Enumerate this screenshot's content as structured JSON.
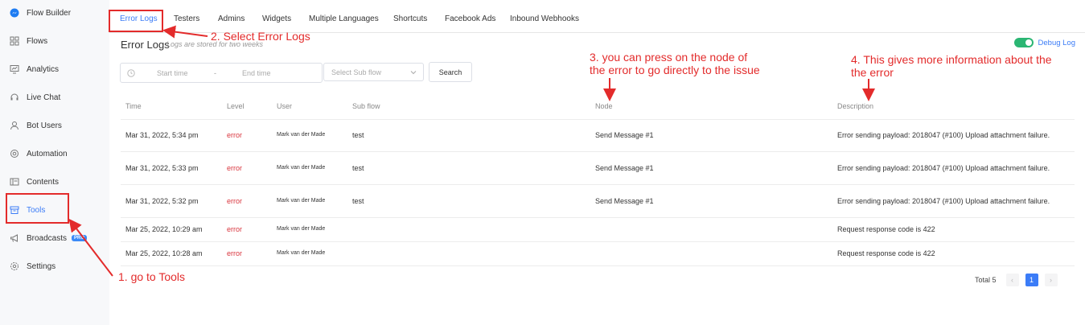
{
  "sidebar": {
    "items": [
      {
        "label": "Flow Builder",
        "icon": "messenger-icon"
      },
      {
        "label": "Flows",
        "icon": "grid-icon"
      },
      {
        "label": "Analytics",
        "icon": "chart-icon"
      },
      {
        "label": "Live Chat",
        "icon": "headset-icon"
      },
      {
        "label": "Bot Users",
        "icon": "user-icon"
      },
      {
        "label": "Automation",
        "icon": "automation-icon"
      },
      {
        "label": "Contents",
        "icon": "contents-icon"
      },
      {
        "label": "Tools",
        "icon": "tools-icon"
      },
      {
        "label": "Broadcasts",
        "icon": "megaphone-icon",
        "badge": "PRO"
      },
      {
        "label": "Settings",
        "icon": "gear-icon"
      }
    ],
    "active_item": "Tools"
  },
  "tabs": [
    "Error Logs",
    "Testers",
    "Admins",
    "Widgets",
    "Multiple Languages",
    "Shortcuts",
    "Facebook Ads",
    "Inbound Webhooks"
  ],
  "page": {
    "title": "Error Logs",
    "subtitle": "Logs are stored for two weeks",
    "debug_label": "Debug Log",
    "debug_enabled": true
  },
  "filters": {
    "start_placeholder": "Start time",
    "separator": "-",
    "end_placeholder": "End time",
    "subflow_placeholder": "Select Sub flow",
    "search_label": "Search"
  },
  "table": {
    "headers": [
      "Time",
      "Level",
      "User",
      "Sub flow",
      "Node",
      "Description"
    ],
    "rows": [
      {
        "time": "Mar 31, 2022, 5:34 pm",
        "level": "error",
        "user": "Mark van der Made",
        "subflow": "test",
        "node": "Send Message #1",
        "description": "Error sending payload: 2018047 (#100) Upload attachment failure."
      },
      {
        "time": "Mar 31, 2022, 5:33 pm",
        "level": "error",
        "user": "Mark van der Made",
        "subflow": "test",
        "node": "Send Message #1",
        "description": "Error sending payload: 2018047 (#100) Upload attachment failure."
      },
      {
        "time": "Mar 31, 2022, 5:32 pm",
        "level": "error",
        "user": "Mark van der Made",
        "subflow": "test",
        "node": "Send Message #1",
        "description": "Error sending payload: 2018047 (#100) Upload attachment failure."
      },
      {
        "time": "Mar 25, 2022, 10:29 am",
        "level": "error",
        "user": "Mark van der Made",
        "subflow": "",
        "node": "",
        "description": "Request response code is 422"
      },
      {
        "time": "Mar 25, 2022, 10:28 am",
        "level": "error",
        "user": "Mark van der Made",
        "subflow": "",
        "node": "",
        "description": "Request response code is 422"
      }
    ]
  },
  "pagination": {
    "total_label": "Total 5",
    "current_page": "1",
    "prev": "‹",
    "next": "›"
  },
  "annotations": {
    "step1": "1. go to Tools",
    "step2": "2. Select Error Logs",
    "step3_line1": "3. you can press on the node of",
    "step3_line2": "the error to go directly to the issue",
    "step4_line1": "4. This gives more information about the",
    "step4_line2": "the error"
  },
  "colors": {
    "accent": "#3b7cf7",
    "error": "#d9363e",
    "annotation": "#e32b2b",
    "toggle_on": "#2bb673"
  }
}
